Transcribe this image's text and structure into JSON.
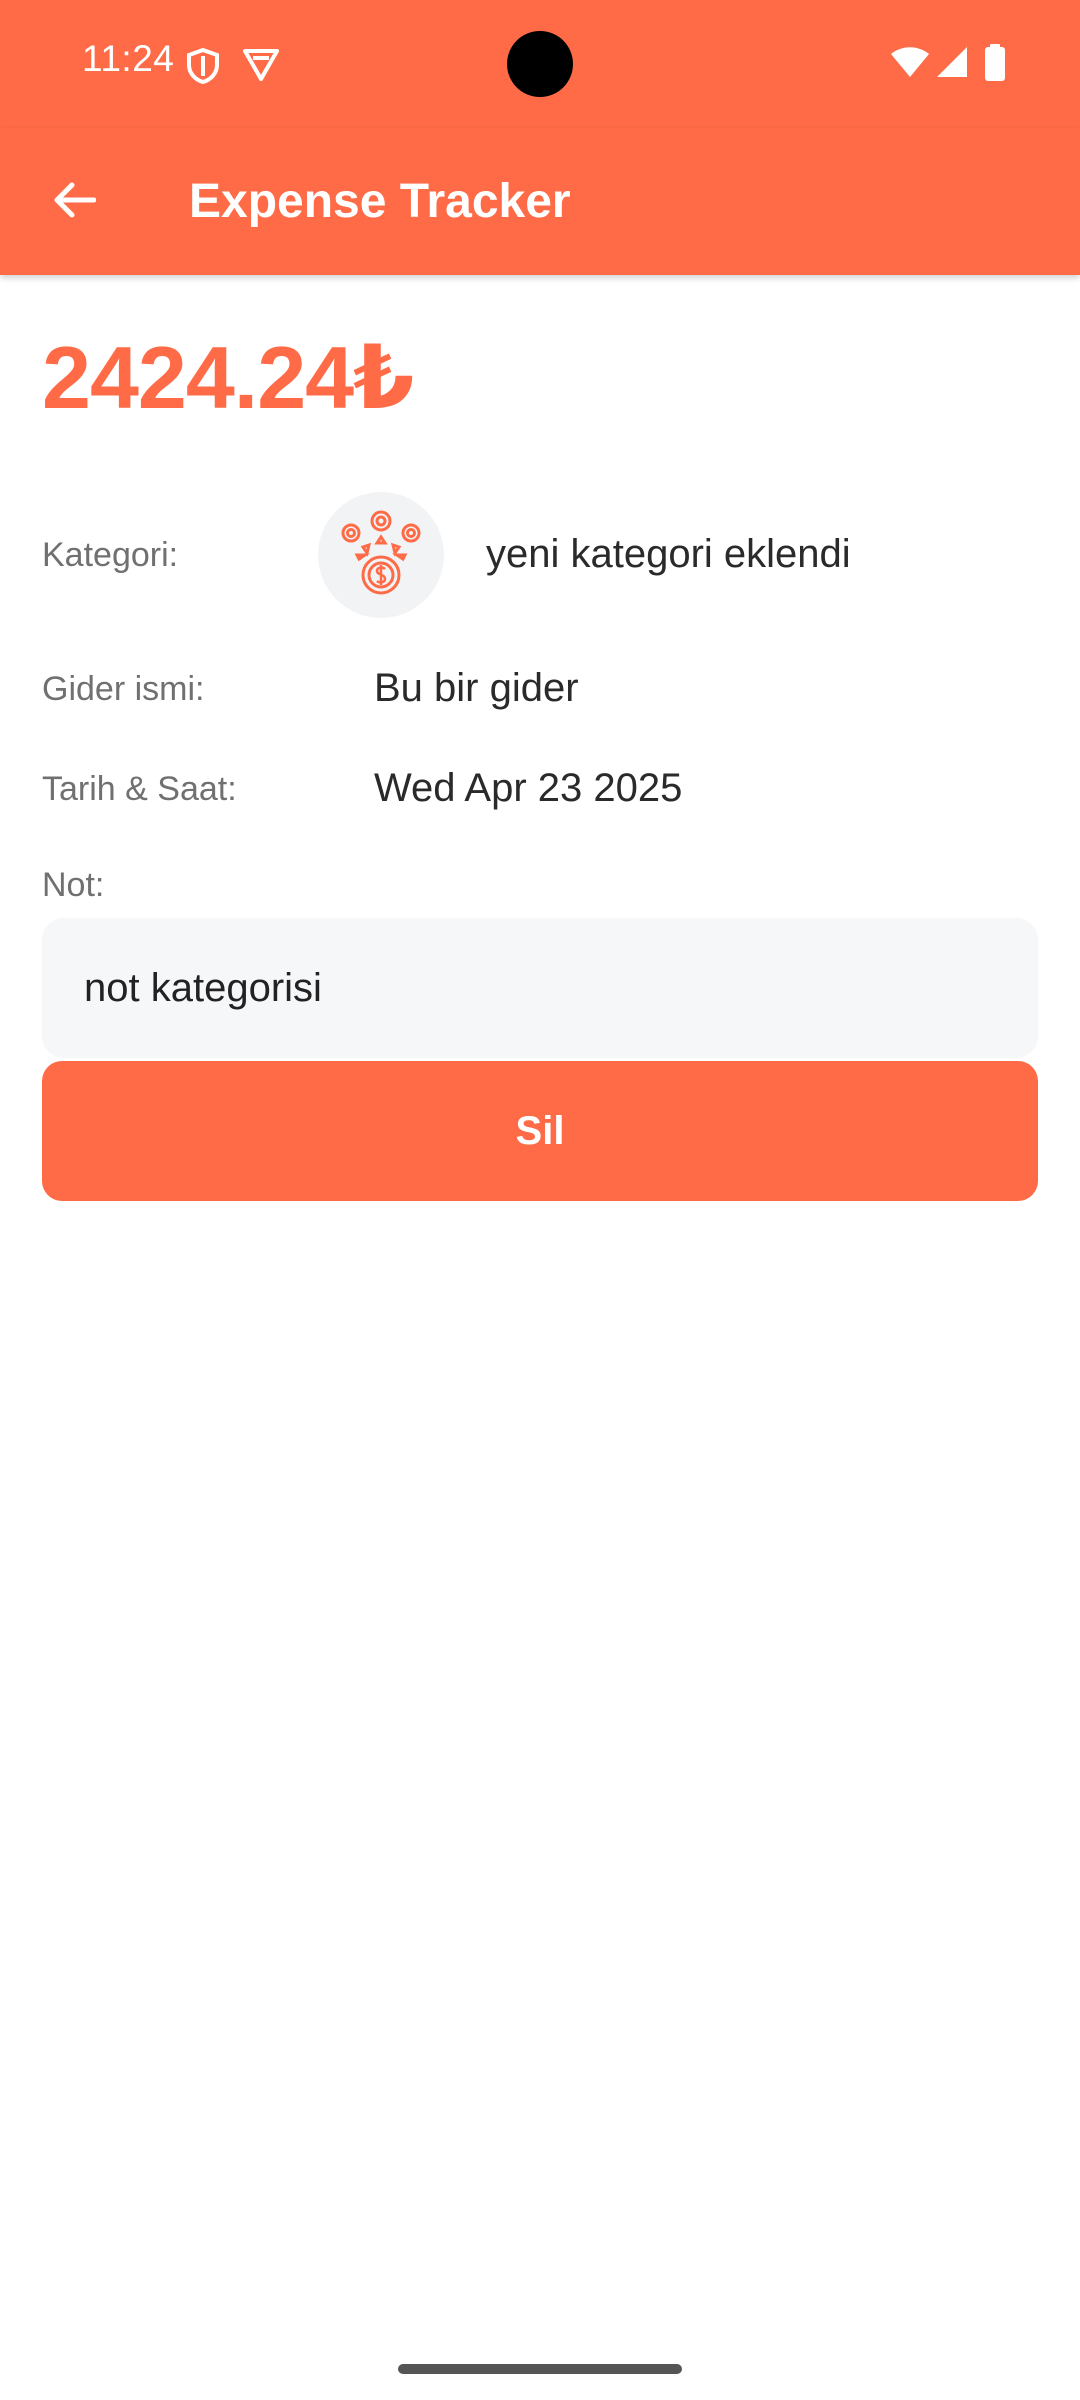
{
  "status_bar": {
    "time": "11:24",
    "left_icons": [
      "shield-icon",
      "vpn-badge-icon"
    ],
    "right_icons": [
      "wifi-icon",
      "cell-signal-icon",
      "battery-icon"
    ]
  },
  "app_bar": {
    "title": "Expense Tracker",
    "back_icon": "arrow-back-icon"
  },
  "expense": {
    "amount": "2424.24₺",
    "category_label": "Kategori:",
    "category_name": "yeni kategori eklendi",
    "category_icon": "money-category-icon",
    "name_label": "Gider ismi:",
    "name_value": "Bu bir gider",
    "datetime_label": "Tarih & Saat:",
    "datetime_value": "Wed Apr 23 2025",
    "note_label": "Not:",
    "note_value": "not kategorisi"
  },
  "actions": {
    "delete_label": "Sil"
  },
  "colors": {
    "accent": "#ff6b47",
    "background": "#ffffff",
    "note_background": "#f6f7f9"
  }
}
